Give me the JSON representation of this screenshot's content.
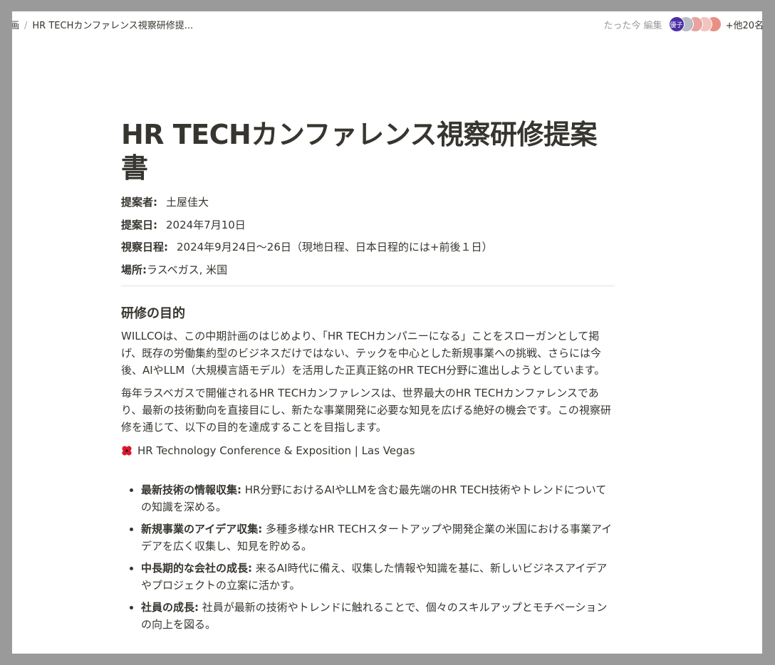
{
  "breadcrumb": {
    "parent": "画",
    "current": "HR TECHカンファレンス視察研修提..."
  },
  "topbar": {
    "edited": "たった今 編集",
    "more_label": "+他20名",
    "avatars": [
      {
        "label": "優子",
        "color": "#4b2ea6"
      },
      {
        "label": "",
        "color": "#b8bcc4"
      },
      {
        "label": "",
        "color": "#e8a3a0"
      },
      {
        "label": "",
        "color": "#f1c4c0"
      },
      {
        "label": "",
        "color": "#e79086"
      }
    ]
  },
  "document": {
    "title": "HR TECHカンファレンス視察研修提案書",
    "meta": [
      {
        "key": "提案者:",
        "value": "土屋佳大"
      },
      {
        "key": "提案日:",
        "value": "2024年7月10日"
      },
      {
        "key": "視察日程:",
        "value": "2024年9月24日〜26日（現地日程、日本日程的には+前後１日）"
      },
      {
        "key": "場所:",
        "value": "ラスベガス, 米国"
      }
    ],
    "section_heading": "研修の目的",
    "paragraphs": [
      "WILLCOは、この中期計画のはじめより、「HR TECHカンパニーになる」ことをスローガンとして掲げ、既存の労働集約型のビジネスだけではない、テックを中心とした新規事業への挑戦、さらには今後、AIやLLM（大規模言語モデル）を活用した正真正銘のHR TECH分野に進出しようとしています。",
      "毎年ラスベガスで開催されるHR TECHカンファレンスは、世界最大のHR TECHカンファレンスであり、最新の技術動向を直接目にし、新たな事業開発に必要な知見を広げる絶好の機会です。この視察研修を通じて、以下の目的を達成することを目指します。"
    ],
    "link_text": "HR Technology Conference & Exposition | Las Vegas",
    "bullets": [
      {
        "bold": "最新技術の情報収集:",
        "text": " HR分野におけるAIやLLMを含む最先端のHR TECH技術やトレンドについての知識を深める。"
      },
      {
        "bold": "新規事業のアイデア収集:",
        "text": " 多種多様なHR TECHスタートアップや開発企業の米国における事業アイデアを広く収集し、知見を貯める。"
      },
      {
        "bold": "中長期的な会社の成長:",
        "text": " 来るAI時代に備え、収集した情報や知識を基に、新しいビジネスアイデアやプロジェクトの立案に活かす。"
      },
      {
        "bold": "社員の成長:",
        "text": " 社員が最新の技術やトレンドに触れることで、個々のスキルアップとモチベーションの向上を図る。"
      }
    ]
  }
}
